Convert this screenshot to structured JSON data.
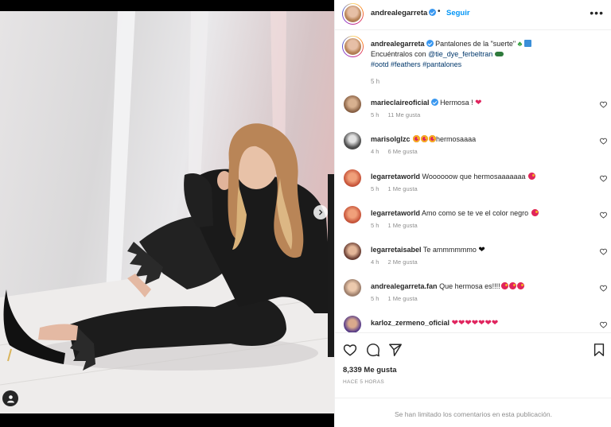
{
  "post": {
    "username": "andrealegarreta",
    "follow_label": "Seguir",
    "separator": "•",
    "more_label": "•••"
  },
  "caption": {
    "username": "andrealegarreta",
    "text_1": "Pantalones de la \"suerte\"",
    "text_2": "Encuéntralos con",
    "mention": "@tie_dye_ferbeltran",
    "hashtags": [
      "#ootd",
      "#feathers",
      "#pantalones"
    ],
    "time": "5 h"
  },
  "comments": [
    {
      "username": "marieclaireoficial",
      "verified": true,
      "text": "Hermosa !",
      "emoji": "heart",
      "time": "5 h",
      "likes": "11 Me gusta"
    },
    {
      "username": "marisolglzc",
      "verified": false,
      "text": "hermosaaaa",
      "emoji_prefix": "heart-eyes x3",
      "time": "4 h",
      "likes": "6 Me gusta"
    },
    {
      "username": "legarretaworld",
      "verified": false,
      "text": "Woooooow que hermosaaaaaaa",
      "emoji": "heart-eyes",
      "time": "5 h",
      "likes": "1 Me gusta"
    },
    {
      "username": "legarretaworld",
      "verified": false,
      "text": "Amo como se te ve el color negro",
      "emoji": "heart-eyes",
      "time": "5 h",
      "likes": "1 Me gusta"
    },
    {
      "username": "legarretaisabel",
      "verified": false,
      "text": "Te ammmmmmo",
      "emoji": "black-heart",
      "time": "4 h",
      "likes": "2 Me gusta"
    },
    {
      "username": "andrealegarreta.fan",
      "verified": false,
      "text": "Que hermosa es!!!!",
      "emoji": "heart-eyes x3",
      "time": "5 h",
      "likes": "1 Me gusta"
    },
    {
      "username": "karloz_zermeno_oficial",
      "verified": false,
      "text": "",
      "emoji": "red-heart x7",
      "time": "",
      "likes": ""
    }
  ],
  "actions": {
    "likes": "8,339 Me gusta",
    "date": "HACE 5 HORAS"
  },
  "footer": {
    "text": "Se han limitado los comentarios en esta publicación."
  },
  "colors": {
    "accent": "#0095f6",
    "verified": "#3897f0",
    "muted": "#8e8e8e",
    "heart": "#e0245e"
  }
}
